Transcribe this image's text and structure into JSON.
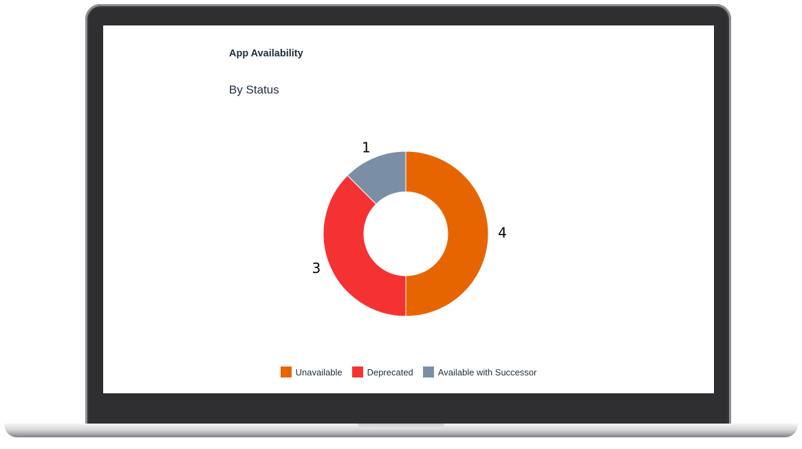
{
  "card": {
    "title": "App Availability",
    "subtitle": "By Status"
  },
  "chart_data": {
    "type": "pie",
    "style": "donut",
    "title": "App Availability",
    "subtitle": "By Status",
    "series": [
      {
        "name": "Unavailable",
        "value": 4,
        "color": "#e76500"
      },
      {
        "name": "Deprecated",
        "value": 3,
        "color": "#f53232"
      },
      {
        "name": "Available with Successor",
        "value": 1,
        "color": "#7a8fa6"
      }
    ],
    "data_labels": [
      "4",
      "3",
      "1"
    ],
    "legend_position": "bottom"
  }
}
